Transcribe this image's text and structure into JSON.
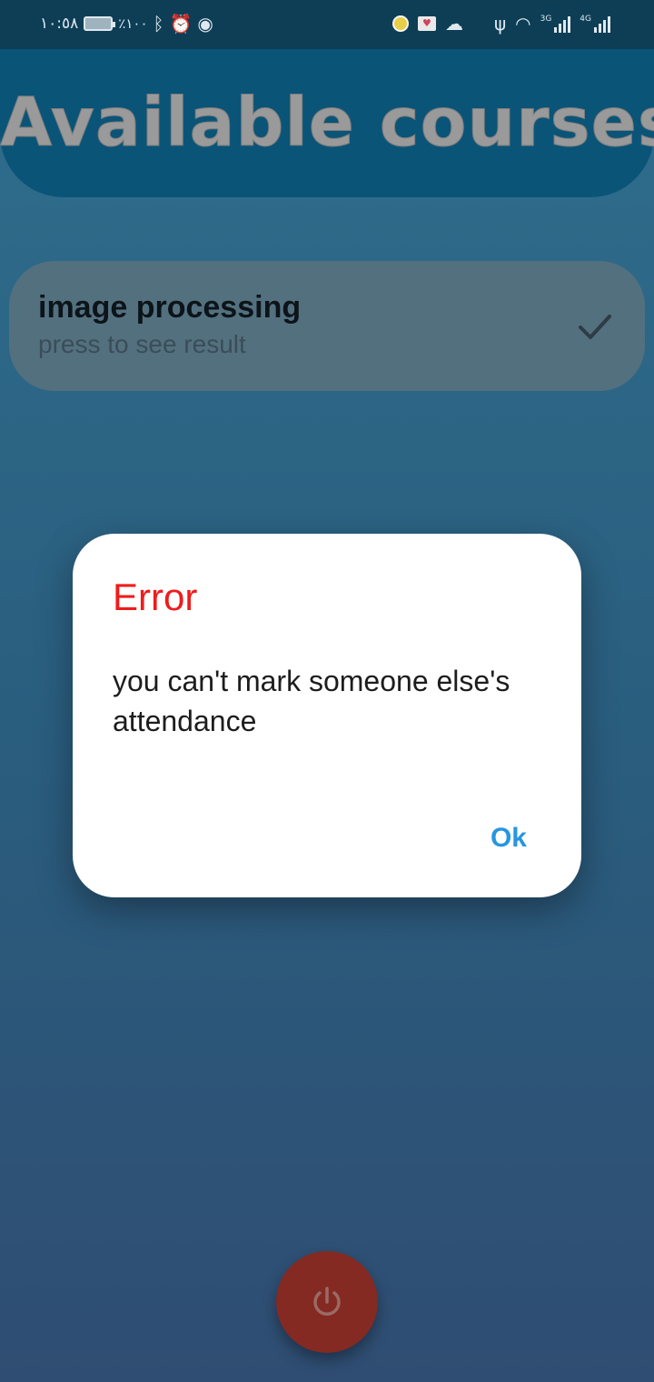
{
  "status_bar": {
    "time": "١٠:٥٨",
    "battery": "٪١٠٠",
    "network_3g": "3G",
    "network_4g": "4G",
    "icons": [
      "battery-icon",
      "bluetooth-icon",
      "alarm-icon",
      "eye-icon",
      "notification-icon",
      "mail-icon",
      "cloud-icon",
      "usb-icon",
      "wifi-icon",
      "signal-icon"
    ]
  },
  "header": {
    "title": "Available courses"
  },
  "course": {
    "title": "image processing",
    "subtitle": "press to see result",
    "status_icon": "check-icon"
  },
  "dialog": {
    "title": "Error",
    "message": "you can't mark someone else's attendance",
    "ok_label": "Ok"
  },
  "fab": {
    "icon": "power-icon"
  },
  "colors": {
    "error": "#ef1c1c",
    "accent": "#2796e0",
    "header": "#0a5478",
    "power": "#842a22"
  }
}
